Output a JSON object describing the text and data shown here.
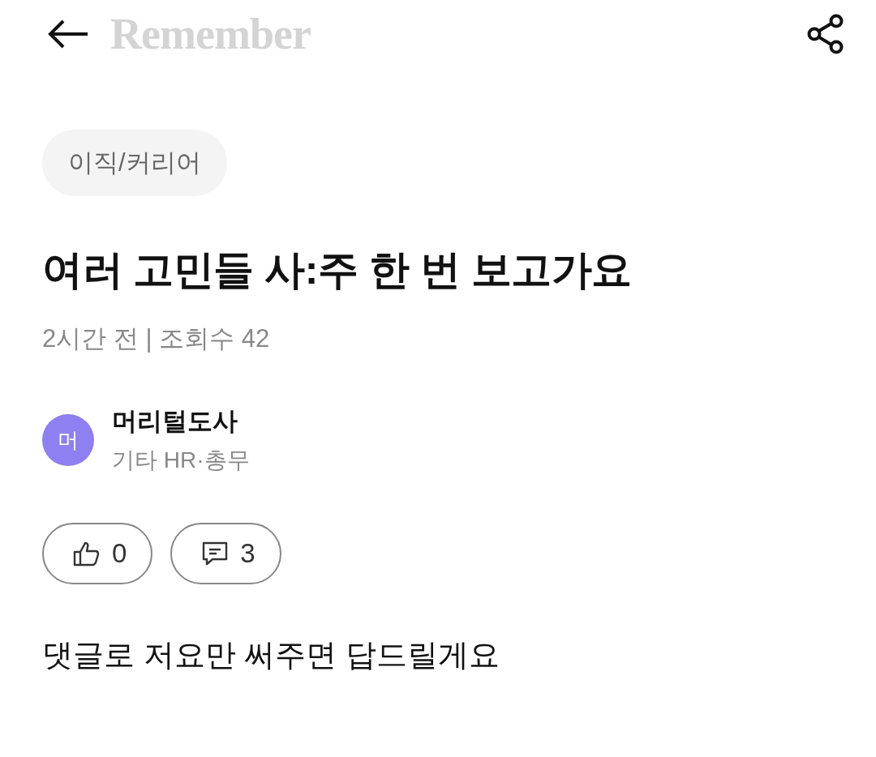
{
  "header": {
    "logo": "Remember"
  },
  "post": {
    "category": "이직/커리어",
    "title": "여러 고민들 사:주 한 번 보고가요",
    "meta": "2시간 전 | 조회수 42",
    "author": {
      "initial": "머",
      "name": "머리털도사",
      "role": "기타 HR·총무",
      "color": "#8d80f0"
    },
    "actions": [
      {
        "kind": "like",
        "count": "0"
      },
      {
        "kind": "comment",
        "count": "3"
      }
    ],
    "body": "댓글로 저요만 써주면 답드릴게요"
  }
}
